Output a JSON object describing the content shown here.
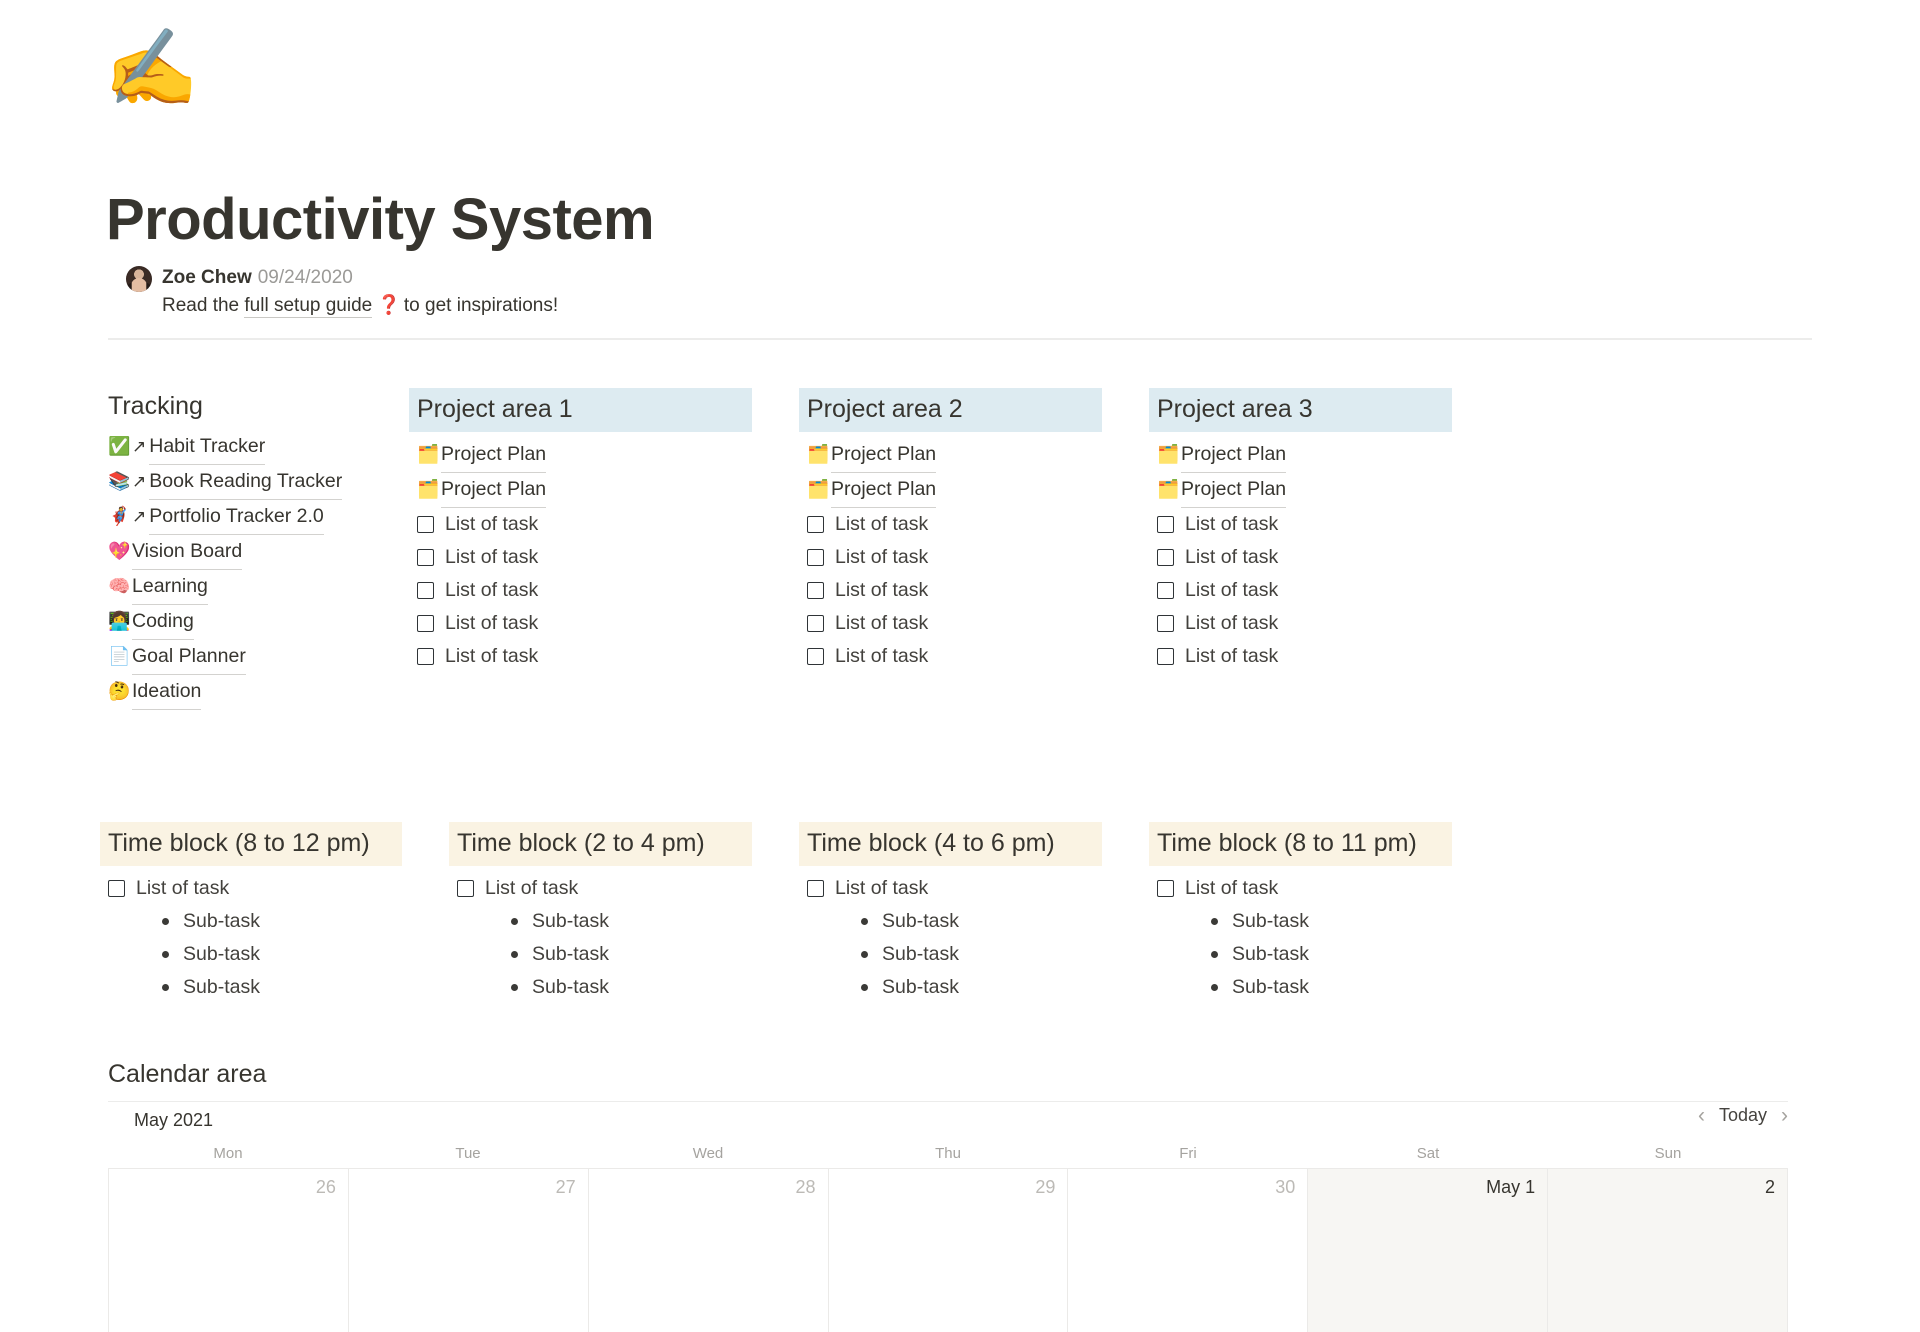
{
  "header": {
    "cover_emoji": "✍️",
    "title": "Productivity System",
    "author": "Zoe Chew",
    "date": "09/24/2020",
    "subtitle_prefix": "Read the",
    "subtitle_link": "full setup guide",
    "subtitle_question_icon": "❓",
    "subtitle_suffix": "to get inspirations!"
  },
  "columns": [
    {
      "heading": "Tracking",
      "heading_style": "plain",
      "links": [
        {
          "emoji": "✅",
          "arrow": "↗",
          "label": "Habit Tracker"
        },
        {
          "emoji": "📚",
          "arrow": "↗",
          "label": "Book Reading Tracker"
        },
        {
          "emoji": "🦸",
          "arrow": "↗",
          "label": "Portfolio Tracker 2.0"
        },
        {
          "emoji": "💖",
          "arrow": "",
          "label": "Vision Board"
        },
        {
          "emoji": "🧠",
          "arrow": "",
          "label": "Learning"
        },
        {
          "emoji": "👩‍💻",
          "arrow": "",
          "label": "Coding"
        },
        {
          "emoji": "📄",
          "arrow": "",
          "label": "Goal Planner"
        },
        {
          "emoji": "🤔",
          "arrow": "",
          "label": "Ideation"
        }
      ],
      "tasks": []
    },
    {
      "heading": "Project area 1",
      "heading_style": "blue",
      "links": [
        {
          "emoji": "🗂️",
          "arrow": "",
          "label": "Project Plan"
        },
        {
          "emoji": "🗂️",
          "arrow": "",
          "label": "Project Plan"
        }
      ],
      "tasks": [
        "List of task",
        "List of task",
        "List of task",
        "List of task",
        "List of task"
      ]
    },
    {
      "heading": "Project area 2",
      "heading_style": "blue",
      "links": [
        {
          "emoji": "🗂️",
          "arrow": "",
          "label": "Project Plan"
        },
        {
          "emoji": "🗂️",
          "arrow": "",
          "label": "Project Plan"
        }
      ],
      "tasks": [
        "List of task",
        "List of task",
        "List of task",
        "List of task",
        "List of task"
      ]
    },
    {
      "heading": "Project area 3",
      "heading_style": "blue",
      "links": [
        {
          "emoji": "🗂️",
          "arrow": "",
          "label": "Project Plan"
        },
        {
          "emoji": "🗂️",
          "arrow": "",
          "label": "Project Plan"
        }
      ],
      "tasks": [
        "List of task",
        "List of task",
        "List of task",
        "List of task",
        "List of task"
      ]
    }
  ],
  "time_blocks": [
    {
      "heading": "Time block (8 to 12 pm)",
      "task": "List of task",
      "subtasks": [
        "Sub-task",
        "Sub-task",
        "Sub-task"
      ]
    },
    {
      "heading": "Time block (2 to 4 pm)",
      "task": "List of task",
      "subtasks": [
        "Sub-task",
        "Sub-task",
        "Sub-task"
      ]
    },
    {
      "heading": "Time block (4 to 6 pm)",
      "task": "List of task",
      "subtasks": [
        "Sub-task",
        "Sub-task",
        "Sub-task"
      ]
    },
    {
      "heading": "Time block (8 to 11 pm)",
      "task": "List of task",
      "subtasks": [
        "Sub-task",
        "Sub-task",
        "Sub-task"
      ]
    }
  ],
  "calendar": {
    "section_title": "Calendar area",
    "month_label": "May 2021",
    "prev_icon": "‹",
    "today_label": "Today",
    "next_icon": "›",
    "day_names": [
      "Mon",
      "Tue",
      "Wed",
      "Thu",
      "Fri",
      "Sat",
      "Sun"
    ],
    "cells": [
      {
        "label": "26",
        "state": "dim"
      },
      {
        "label": "27",
        "state": "dim"
      },
      {
        "label": "28",
        "state": "dim"
      },
      {
        "label": "29",
        "state": "dim"
      },
      {
        "label": "30",
        "state": "dim"
      },
      {
        "label": "May 1",
        "state": "cur"
      },
      {
        "label": "2",
        "state": "cur"
      }
    ]
  },
  "colors": {
    "text": "#37352f",
    "muted": "#9b9a97",
    "tint_blue": "#ddebf1",
    "tint_cream": "#faf3e3",
    "accent_red": "#c0392b",
    "weekend_cell": "#f7f6f3"
  }
}
